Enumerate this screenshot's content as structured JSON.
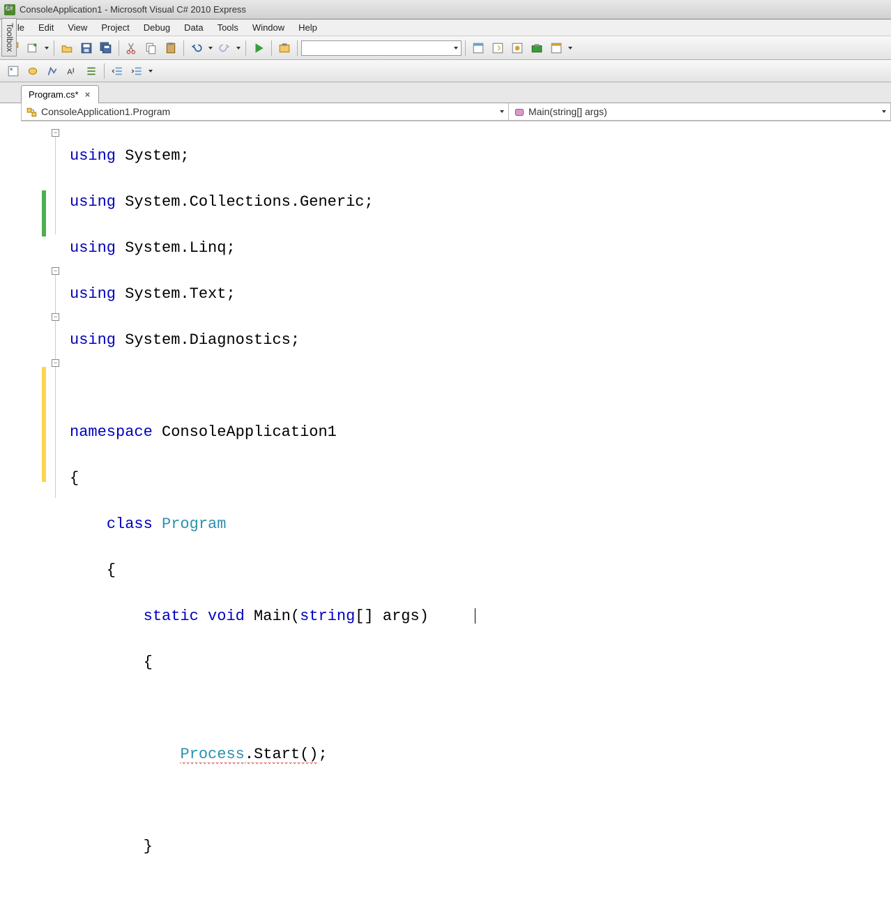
{
  "window": {
    "title": "ConsoleApplication1 - Microsoft Visual C# 2010 Express"
  },
  "menu": {
    "items": [
      "File",
      "Edit",
      "View",
      "Project",
      "Debug",
      "Data",
      "Tools",
      "Window",
      "Help"
    ]
  },
  "tabs": {
    "document": "Program.cs*",
    "toolbox": "Toolbox"
  },
  "nav": {
    "class_combo": "ConsoleApplication1.Program",
    "member_combo": "Main(string[] args)"
  },
  "code": {
    "l1_using": "using",
    "l1_rest": " System;",
    "l2_using": "using",
    "l2_rest": " System.Collections.Generic;",
    "l3_using": "using",
    "l3_rest": " System.Linq;",
    "l4_using": "using",
    "l4_rest": " System.Text;",
    "l5_using": "using",
    "l5_rest": " System.Diagnostics;",
    "l6": "",
    "l7_ns": "namespace",
    "l7_rest": " ConsoleApplication1",
    "l8": "{",
    "l9_sp": "    ",
    "l9_class": "class",
    "l9_sp2": " ",
    "l9_name": "Program",
    "l10": "    {",
    "l11_sp": "        ",
    "l11_static": "static",
    "l11_sp2": " ",
    "l11_void": "void",
    "l11_main": " Main(",
    "l11_string": "string",
    "l11_rest": "[] args)",
    "l12": "        {",
    "l13": "",
    "l14_sp": "            ",
    "l14_proc": "Process",
    "l14_rest": ".Start()",
    "l14_semi": ";",
    "l15": "",
    "l16": "        }"
  },
  "colors": {
    "keyword": "#0000c0",
    "type": "#2b91af",
    "change_green": "#4caf50",
    "change_yellow": "#ffd54f"
  }
}
